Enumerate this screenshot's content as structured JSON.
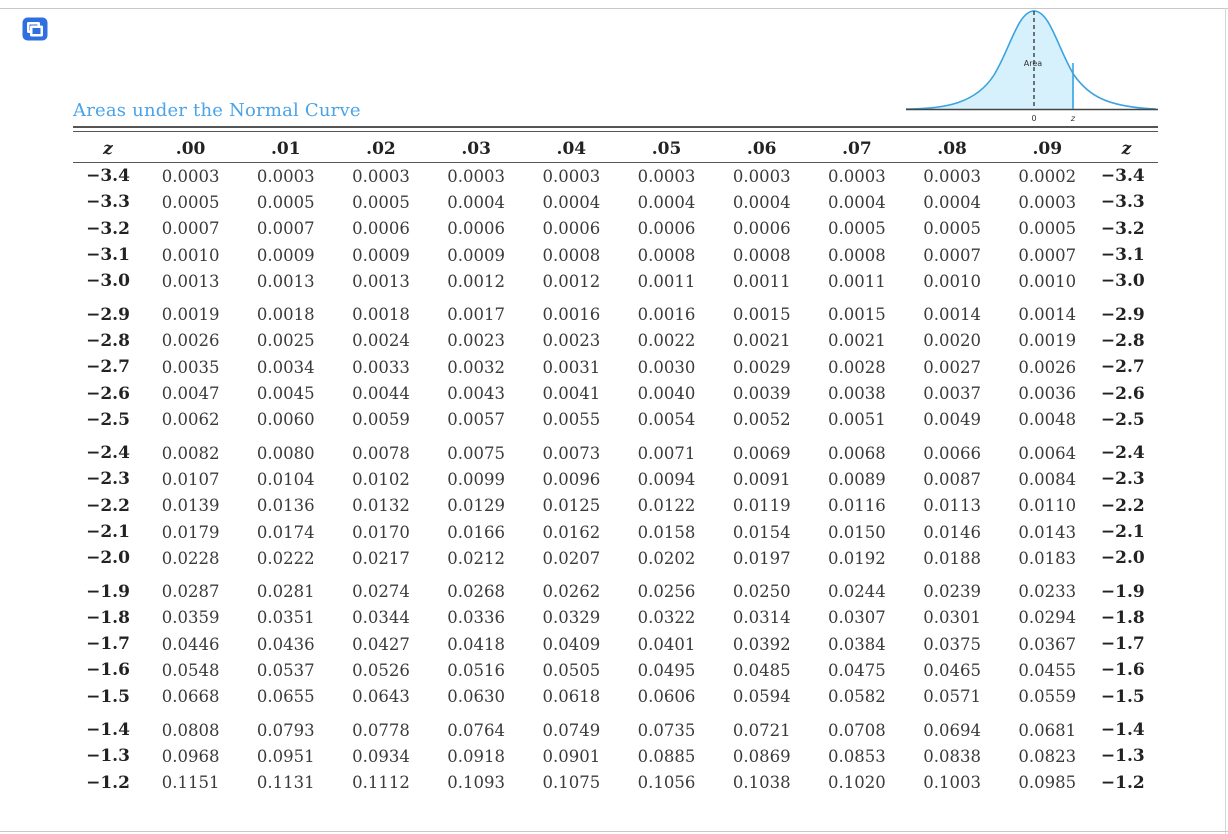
{
  "expand_icon": "expand-window-icon",
  "caption": "Areas under the Normal Curve",
  "figure": {
    "area_label": "Area",
    "zero_label": "0",
    "z_label": "z",
    "fill_color": "#d6f1fb",
    "line_color": "#3aa3e0"
  },
  "table": {
    "headers": [
      "z",
      ".00",
      ".01",
      ".02",
      ".03",
      ".04",
      ".05",
      ".06",
      ".07",
      ".08",
      ".09",
      "z"
    ],
    "rows": [
      {
        "z": "−3.4",
        "v": [
          "0.0003",
          "0.0003",
          "0.0003",
          "0.0003",
          "0.0003",
          "0.0003",
          "0.0003",
          "0.0003",
          "0.0003",
          "0.0002"
        ]
      },
      {
        "z": "−3.3",
        "v": [
          "0.0005",
          "0.0005",
          "0.0005",
          "0.0004",
          "0.0004",
          "0.0004",
          "0.0004",
          "0.0004",
          "0.0004",
          "0.0003"
        ]
      },
      {
        "z": "−3.2",
        "v": [
          "0.0007",
          "0.0007",
          "0.0006",
          "0.0006",
          "0.0006",
          "0.0006",
          "0.0006",
          "0.0005",
          "0.0005",
          "0.0005"
        ]
      },
      {
        "z": "−3.1",
        "v": [
          "0.0010",
          "0.0009",
          "0.0009",
          "0.0009",
          "0.0008",
          "0.0008",
          "0.0008",
          "0.0008",
          "0.0007",
          "0.0007"
        ]
      },
      {
        "z": "−3.0",
        "v": [
          "0.0013",
          "0.0013",
          "0.0013",
          "0.0012",
          "0.0012",
          "0.0011",
          "0.0011",
          "0.0011",
          "0.0010",
          "0.0010"
        ]
      },
      {
        "z": "−2.9",
        "v": [
          "0.0019",
          "0.0018",
          "0.0018",
          "0.0017",
          "0.0016",
          "0.0016",
          "0.0015",
          "0.0015",
          "0.0014",
          "0.0014"
        ]
      },
      {
        "z": "−2.8",
        "v": [
          "0.0026",
          "0.0025",
          "0.0024",
          "0.0023",
          "0.0023",
          "0.0022",
          "0.0021",
          "0.0021",
          "0.0020",
          "0.0019"
        ]
      },
      {
        "z": "−2.7",
        "v": [
          "0.0035",
          "0.0034",
          "0.0033",
          "0.0032",
          "0.0031",
          "0.0030",
          "0.0029",
          "0.0028",
          "0.0027",
          "0.0026"
        ]
      },
      {
        "z": "−2.6",
        "v": [
          "0.0047",
          "0.0045",
          "0.0044",
          "0.0043",
          "0.0041",
          "0.0040",
          "0.0039",
          "0.0038",
          "0.0037",
          "0.0036"
        ]
      },
      {
        "z": "−2.5",
        "v": [
          "0.0062",
          "0.0060",
          "0.0059",
          "0.0057",
          "0.0055",
          "0.0054",
          "0.0052",
          "0.0051",
          "0.0049",
          "0.0048"
        ]
      },
      {
        "z": "−2.4",
        "v": [
          "0.0082",
          "0.0080",
          "0.0078",
          "0.0075",
          "0.0073",
          "0.0071",
          "0.0069",
          "0.0068",
          "0.0066",
          "0.0064"
        ]
      },
      {
        "z": "−2.3",
        "v": [
          "0.0107",
          "0.0104",
          "0.0102",
          "0.0099",
          "0.0096",
          "0.0094",
          "0.0091",
          "0.0089",
          "0.0087",
          "0.0084"
        ]
      },
      {
        "z": "−2.2",
        "v": [
          "0.0139",
          "0.0136",
          "0.0132",
          "0.0129",
          "0.0125",
          "0.0122",
          "0.0119",
          "0.0116",
          "0.0113",
          "0.0110"
        ]
      },
      {
        "z": "−2.1",
        "v": [
          "0.0179",
          "0.0174",
          "0.0170",
          "0.0166",
          "0.0162",
          "0.0158",
          "0.0154",
          "0.0150",
          "0.0146",
          "0.0143"
        ]
      },
      {
        "z": "−2.0",
        "v": [
          "0.0228",
          "0.0222",
          "0.0217",
          "0.0212",
          "0.0207",
          "0.0202",
          "0.0197",
          "0.0192",
          "0.0188",
          "0.0183"
        ]
      },
      {
        "z": "−1.9",
        "v": [
          "0.0287",
          "0.0281",
          "0.0274",
          "0.0268",
          "0.0262",
          "0.0256",
          "0.0250",
          "0.0244",
          "0.0239",
          "0.0233"
        ]
      },
      {
        "z": "−1.8",
        "v": [
          "0.0359",
          "0.0351",
          "0.0344",
          "0.0336",
          "0.0329",
          "0.0322",
          "0.0314",
          "0.0307",
          "0.0301",
          "0.0294"
        ]
      },
      {
        "z": "−1.7",
        "v": [
          "0.0446",
          "0.0436",
          "0.0427",
          "0.0418",
          "0.0409",
          "0.0401",
          "0.0392",
          "0.0384",
          "0.0375",
          "0.0367"
        ]
      },
      {
        "z": "−1.6",
        "v": [
          "0.0548",
          "0.0537",
          "0.0526",
          "0.0516",
          "0.0505",
          "0.0495",
          "0.0485",
          "0.0475",
          "0.0465",
          "0.0455"
        ]
      },
      {
        "z": "−1.5",
        "v": [
          "0.0668",
          "0.0655",
          "0.0643",
          "0.0630",
          "0.0618",
          "0.0606",
          "0.0594",
          "0.0582",
          "0.0571",
          "0.0559"
        ]
      },
      {
        "z": "−1.4",
        "v": [
          "0.0808",
          "0.0793",
          "0.0778",
          "0.0764",
          "0.0749",
          "0.0735",
          "0.0721",
          "0.0708",
          "0.0694",
          "0.0681"
        ]
      },
      {
        "z": "−1.3",
        "v": [
          "0.0968",
          "0.0951",
          "0.0934",
          "0.0918",
          "0.0901",
          "0.0885",
          "0.0869",
          "0.0853",
          "0.0838",
          "0.0823"
        ]
      },
      {
        "z": "−1.2",
        "v": [
          "0.1151",
          "0.1131",
          "0.1112",
          "0.1093",
          "0.1075",
          "0.1056",
          "0.1038",
          "0.1020",
          "0.1003",
          "0.0985"
        ]
      }
    ]
  }
}
